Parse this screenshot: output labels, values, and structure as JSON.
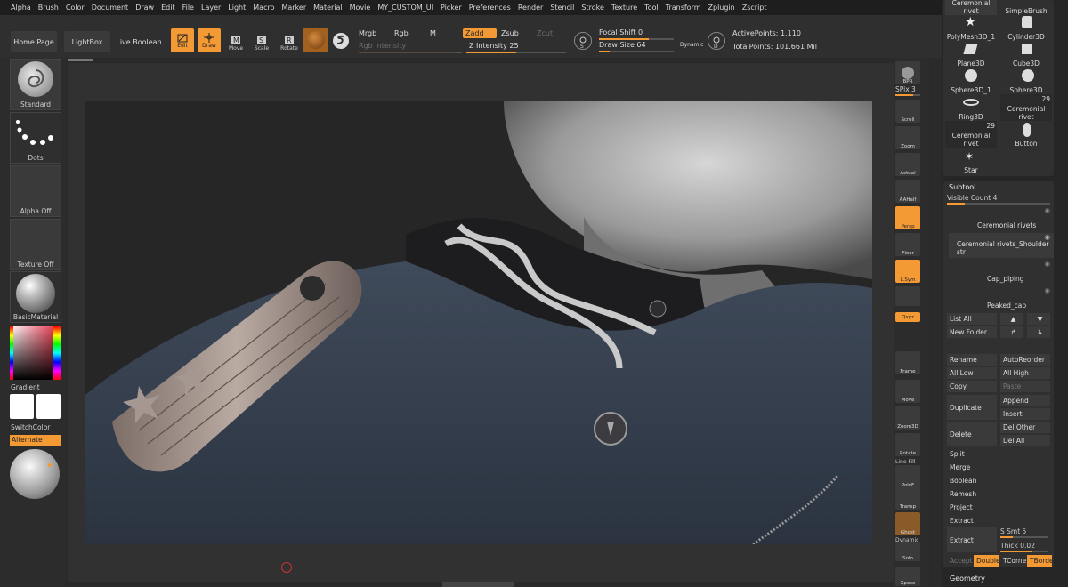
{
  "menu": [
    "Alpha",
    "Brush",
    "Color",
    "Document",
    "Draw",
    "Edit",
    "File",
    "Layer",
    "Light",
    "Macro",
    "Marker",
    "Material",
    "Movie",
    "MY_CUSTOM_UI",
    "Picker",
    "Preferences",
    "Render",
    "Stencil",
    "Stroke",
    "Texture",
    "Tool",
    "Transform",
    "Zplugin",
    "Zscript"
  ],
  "shelf": {
    "home_page": "Home Page",
    "lightbox": "LightBox",
    "live_boolean": "Live Boolean",
    "edit": "Edit",
    "draw": "Draw",
    "move": "Move",
    "scale": "Scale",
    "rotate": "Rotate",
    "mrgb": "Mrgb",
    "rgb": "Rgb",
    "m": "M",
    "rgb_intensity": "Rgb Intensity",
    "zadd": "Zadd",
    "zsub": "Zsub",
    "zcut": "Zcut",
    "z_intensity_label": "Z Intensity",
    "z_intensity_value": "25",
    "focal_shift_label": "Focal Shift",
    "focal_shift_value": "0",
    "draw_size_label": "Draw Size",
    "draw_size_value": "64",
    "dynamic": "Dynamic",
    "active_points": "ActivePoints: 1,110",
    "total_points": "TotalPoints: 101.661 Mil"
  },
  "left": {
    "brush": "Standard",
    "stroke": "Dots",
    "alpha": "Alpha Off",
    "texture": "Texture Off",
    "material": "BasicMaterial",
    "gradient": "Gradient",
    "switch_color": "SwitchColor",
    "alternate": "Alternate"
  },
  "right_shelf": {
    "bpr": "BPR",
    "spix_label": "SPix",
    "spix_value": "3",
    "scroll": "Scroll",
    "zoom": "Zoom",
    "actual": "Actual",
    "aahalf": "AAHalf",
    "persp": "Persp",
    "floor": "Floor",
    "lsym": "L.Sym",
    "xyz": "Qxyz",
    "frame": "Frame",
    "move": "Move",
    "zoom3d": "Zoom3D",
    "rotate": "Rotate",
    "linefill": "Line Fill",
    "polyf": "PolyF",
    "transp": "Transp",
    "ghost": "Ghost",
    "dynamic": "Dynamic",
    "solo": "Solo",
    "xpose": "Xpose"
  },
  "tool_grid": {
    "items": [
      {
        "label": "Ceremonial rivet"
      },
      {
        "label": "SimpleBrush"
      },
      {
        "label": "PolyMesh3D_1"
      },
      {
        "label": "Cylinder3D"
      },
      {
        "label": "Plane3D"
      },
      {
        "label": "Cube3D"
      },
      {
        "label": "Sphere3D_1"
      },
      {
        "label": "Sphere3D"
      },
      {
        "label": "Ring3D"
      },
      {
        "label": "Ceremonial rivet",
        "count": "29"
      },
      {
        "label": "Ceremonial rivet",
        "count": "29"
      },
      {
        "label": "Button"
      },
      {
        "label": "Star"
      }
    ]
  },
  "subtool": {
    "title": "Subtool",
    "visible_count_label": "Visible Count",
    "visible_count_value": "4",
    "items": [
      "Ceremonial rivets",
      "Ceremonial rivets_Shoulder str",
      "Cap_piping",
      "Peaked_cap"
    ],
    "list_all": "List All",
    "new_folder": "New Folder",
    "rename": "Rename",
    "auto_reorder": "AutoReorder",
    "all_low": "All Low",
    "all_high": "All High",
    "copy": "Copy",
    "paste": "Paste",
    "append": "Append",
    "duplicate": "Duplicate",
    "insert": "Insert",
    "delete": "Delete",
    "del_other": "Del Other",
    "del_all": "Del All",
    "split": "Split",
    "merge": "Merge",
    "boolean": "Boolean",
    "remesh": "Remesh",
    "project": "Project",
    "extract_section": "Extract",
    "extract": "Extract",
    "s_smt_label": "S Smt",
    "s_smt_value": "5",
    "thick_label": "Thick",
    "thick_value": "0.02",
    "accept": "Accept",
    "double": "Double",
    "tcorne": "TCorne",
    "tborde": "TBorde",
    "geometry": "Geometry"
  },
  "colors": {
    "accent": "#f39a35",
    "panel": "#2f2f2f",
    "background": "#2a2a2a"
  }
}
